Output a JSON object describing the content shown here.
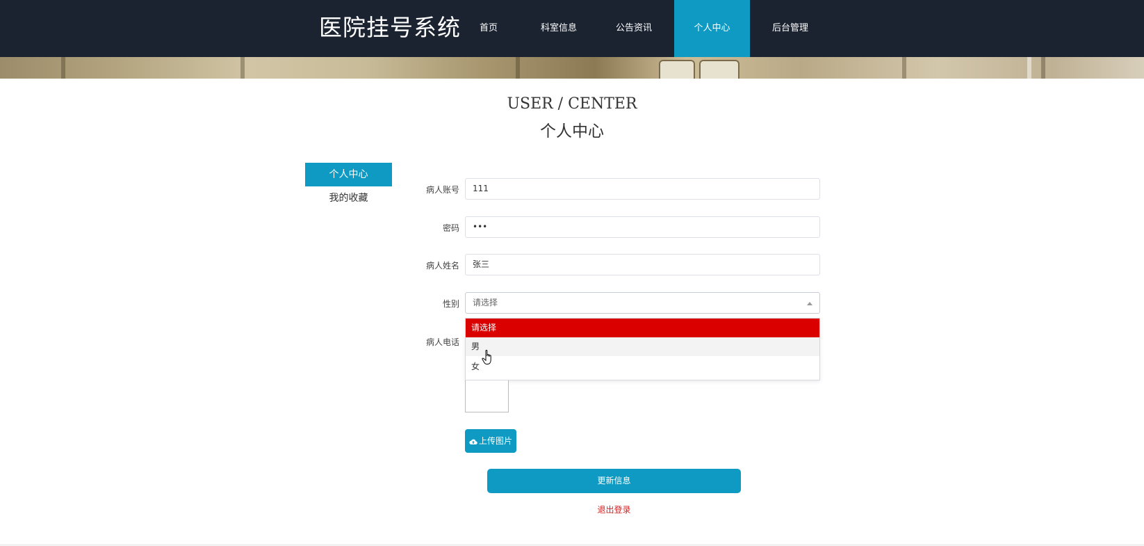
{
  "site": {
    "title": "医院挂号系统"
  },
  "nav": {
    "items": [
      {
        "label": "首页"
      },
      {
        "label": "科室信息"
      },
      {
        "label": "公告资讯"
      },
      {
        "label": "个人中心"
      },
      {
        "label": "后台管理"
      }
    ],
    "active": "个人中心"
  },
  "heading": {
    "en": "USER / CENTER",
    "cn": "个人中心"
  },
  "sidebar": {
    "items": [
      {
        "label": "个人中心"
      },
      {
        "label": "我的收藏"
      }
    ]
  },
  "form": {
    "account": {
      "label": "病人账号",
      "value": "111"
    },
    "password": {
      "label": "密码",
      "value": "•••"
    },
    "name": {
      "label": "病人姓名",
      "value": "张三"
    },
    "gender": {
      "label": "性别",
      "value": "请选择",
      "options": [
        "请选择",
        "男",
        "女"
      ]
    },
    "phone": {
      "label": "病人电话"
    },
    "upload_label": "上传图片",
    "update_label": "更新信息",
    "logout_label": "退出登录"
  },
  "colors": {
    "nav_bg": "#1b2331",
    "accent": "#0e9ac2",
    "selected_option": "#db0000",
    "logout": "#d31f1f"
  }
}
